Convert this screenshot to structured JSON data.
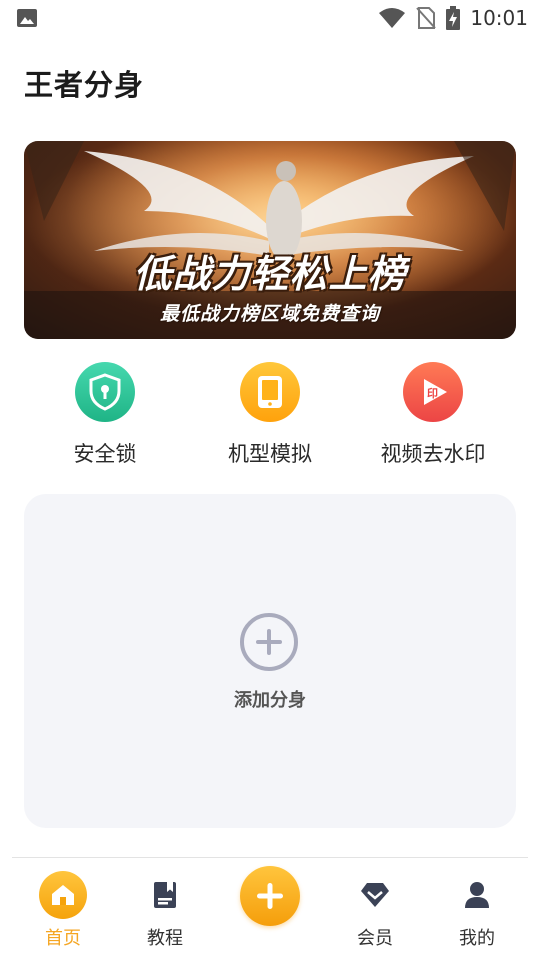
{
  "status_bar": {
    "time": "10:01",
    "icons": [
      "image-icon",
      "wifi-icon",
      "no-sim-icon",
      "battery-charging-icon"
    ]
  },
  "header": {
    "title": "王者分身"
  },
  "banner": {
    "headline": "低战力轻松上榜",
    "subline": "最低战力榜区域免费查询"
  },
  "tools": [
    {
      "label": "安全锁",
      "icon": "shield-lock-icon",
      "color": "#2fc49b"
    },
    {
      "label": "机型模拟",
      "icon": "tablet-icon",
      "color": "#ffb21a"
    },
    {
      "label": "视频去水印",
      "icon": "play-stamp-icon",
      "color": "#f25a4a"
    }
  ],
  "add_card": {
    "label": "添加分身",
    "icon": "plus-circle-icon"
  },
  "bottom_nav": {
    "items": [
      {
        "label": "首页",
        "icon": "home-icon",
        "active": true
      },
      {
        "label": "教程",
        "icon": "book-icon",
        "active": false
      },
      {
        "label": "",
        "icon": "plus-icon",
        "active": false
      },
      {
        "label": "会员",
        "icon": "diamond-icon",
        "active": false
      },
      {
        "label": "我的",
        "icon": "person-icon",
        "active": false
      }
    ],
    "accent": "#f5a623",
    "inactive_icon_color": "#3b4256"
  }
}
